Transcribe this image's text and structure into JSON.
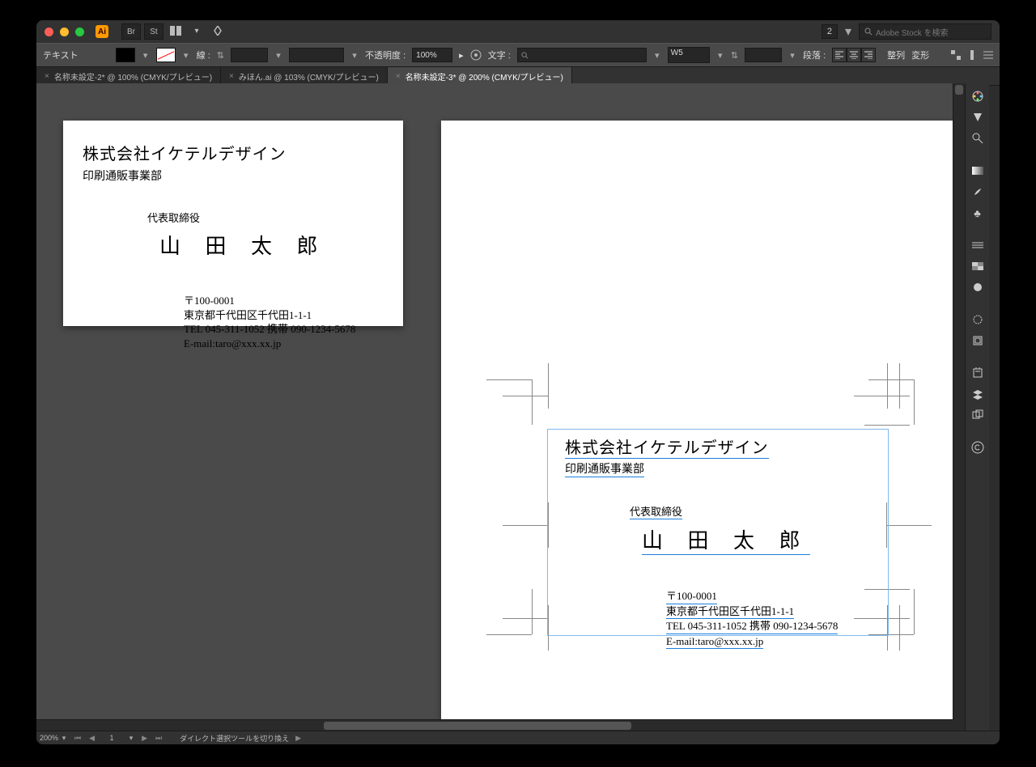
{
  "titlebar": {
    "stock_placeholder": "Adobe Stock を検索",
    "stock_count": "2"
  },
  "controlbar": {
    "mode_label": "テキスト",
    "stroke_label": "線 :",
    "opacity_label": "不透明度 :",
    "opacity_value": "100%",
    "char_label": "文字 :",
    "weight_value": "W5",
    "para_label": "段落 :",
    "align_label": "整列",
    "transform_label": "変形"
  },
  "tabs": [
    {
      "close": "×",
      "label": "名称未設定-2* @ 100% (CMYK/プレビュー)"
    },
    {
      "close": "×",
      "label": "みほん.ai @ 103% (CMYK/プレビュー)"
    },
    {
      "close": "×",
      "label": "名称未設定-3* @ 200% (CMYK/プレビュー)"
    }
  ],
  "card": {
    "company": "株式会社イケテルデザイン",
    "division": "印刷通販事業部",
    "title": "代表取締役",
    "name": "山 田 太 郎",
    "postal": "〒100-0001",
    "address": "東京都千代田区千代田1-1-1",
    "phone": "TEL 045-311-1052  携帯 090-1234-5678",
    "email": "E-mail:taro@xxx.xx.jp"
  },
  "status": {
    "zoom": "200%",
    "page": "1",
    "tool_status": "ダイレクト選択ツールを切り換え"
  }
}
